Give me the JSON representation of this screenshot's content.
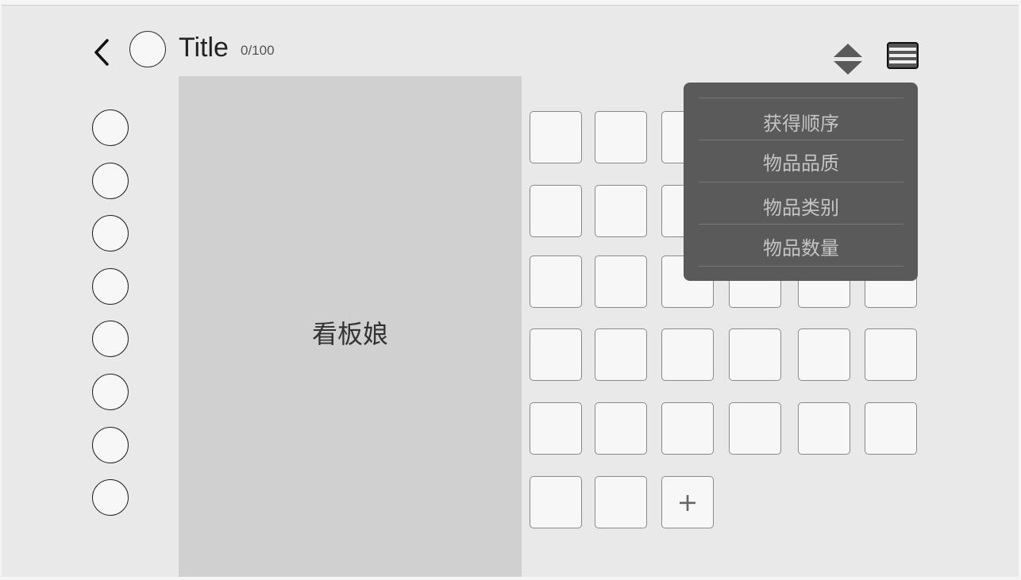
{
  "header": {
    "title": "Title",
    "counter": "0/100",
    "back_icon": "chevron-left-icon",
    "sort_icon": "sort-updown-icon",
    "menu_icon": "hamburger-menu-icon"
  },
  "mascot": {
    "label": "看板娘"
  },
  "sidebar": {
    "count": 8
  },
  "grid": {
    "add_label": "+"
  },
  "sort_menu": {
    "items": [
      {
        "label": "获得顺序"
      },
      {
        "label": "物品品质"
      },
      {
        "label": "物品类别"
      },
      {
        "label": "物品数量"
      }
    ]
  },
  "colors": {
    "background": "#e9e9e9",
    "panel": "#d0d0d0",
    "dropdown": "#5a5a5a",
    "dropdown_text": "#c4c4c4"
  }
}
